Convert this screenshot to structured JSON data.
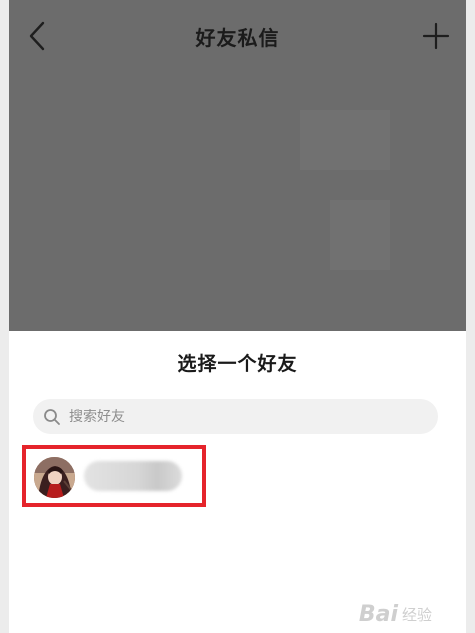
{
  "header": {
    "title": "好友私信",
    "back_icon": "chevron-left-icon",
    "add_icon": "plus-icon"
  },
  "sheet": {
    "title": "选择一个好友",
    "search": {
      "placeholder": "搜索好友",
      "value": "",
      "icon": "search-icon"
    },
    "friends": [
      {
        "name": "",
        "avatar": "anime-avatar",
        "highlighted": true
      }
    ]
  },
  "watermark": {
    "logo": "Bai",
    "text": "经验"
  },
  "colors": {
    "backdrop": "#6c6c6c",
    "highlight_border": "#e5242b",
    "search_bg": "#f1f1f1",
    "sheet_bg": "#ffffff"
  }
}
